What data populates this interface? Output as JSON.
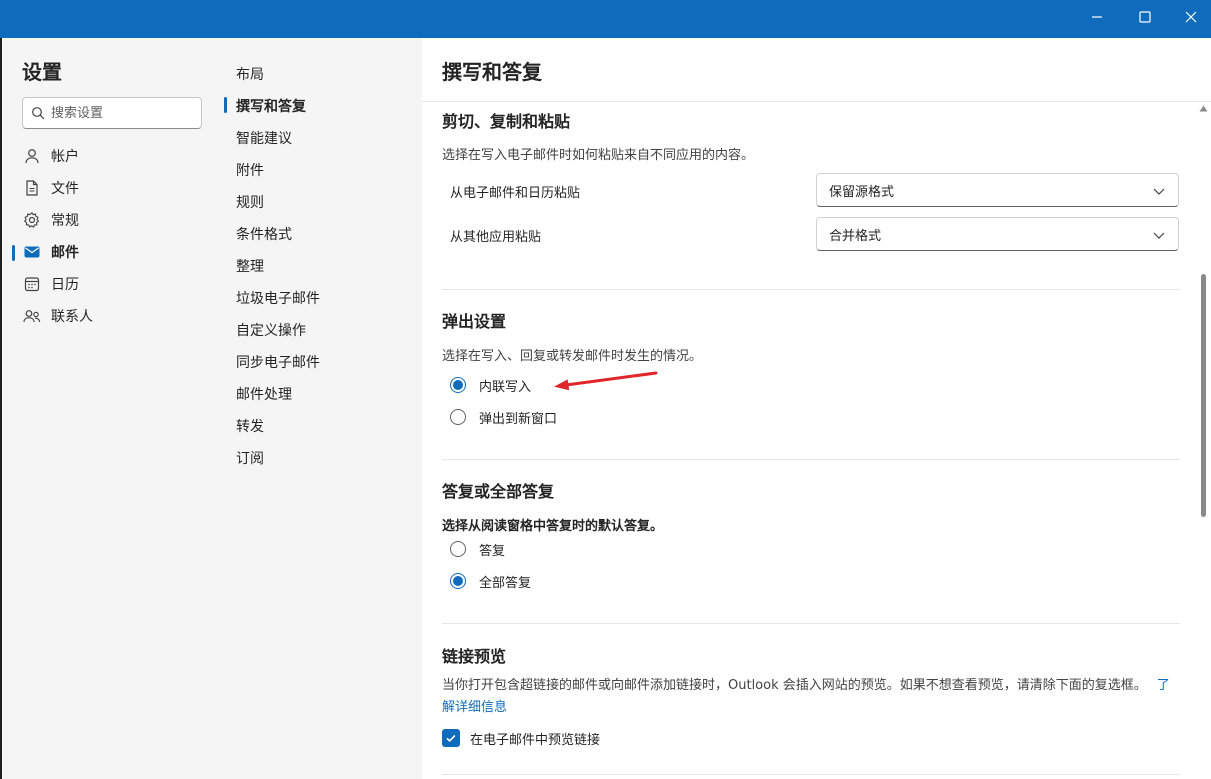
{
  "sidebar": {
    "title": "设置",
    "search_placeholder": "搜索设置",
    "items": [
      {
        "label": "帐户",
        "icon": "person-icon"
      },
      {
        "label": "文件",
        "icon": "document-icon"
      },
      {
        "label": "常规",
        "icon": "gear-icon"
      },
      {
        "label": "邮件",
        "icon": "mail-icon",
        "active": true
      },
      {
        "label": "日历",
        "icon": "calendar-icon"
      },
      {
        "label": "联系人",
        "icon": "people-icon"
      }
    ]
  },
  "subnav": {
    "items": [
      {
        "label": "布局"
      },
      {
        "label": "撰写和答复",
        "active": true
      },
      {
        "label": "智能建议"
      },
      {
        "label": "附件"
      },
      {
        "label": "规则"
      },
      {
        "label": "条件格式"
      },
      {
        "label": "整理"
      },
      {
        "label": "垃圾电子邮件"
      },
      {
        "label": "自定义操作"
      },
      {
        "label": "同步电子邮件"
      },
      {
        "label": "邮件处理"
      },
      {
        "label": "转发"
      },
      {
        "label": "订阅"
      }
    ]
  },
  "main": {
    "title": "撰写和答复",
    "paste": {
      "heading": "剪切、复制和粘贴",
      "description": "选择在写入电子邮件时如何粘贴来自不同应用的内容。",
      "rows": [
        {
          "label": "从电子邮件和日历粘贴",
          "value": "保留源格式"
        },
        {
          "label": "从其他应用粘贴",
          "value": "合并格式"
        }
      ]
    },
    "popout": {
      "heading": "弹出设置",
      "description": "选择在写入、回复或转发邮件时发生的情况。",
      "options": [
        {
          "label": "内联写入",
          "selected": true
        },
        {
          "label": "弹出到新窗口",
          "selected": false
        }
      ]
    },
    "reply": {
      "heading": "答复或全部答复",
      "description": "选择从阅读窗格中答复时的默认答复。",
      "options": [
        {
          "label": "答复",
          "selected": false
        },
        {
          "label": "全部答复",
          "selected": true
        }
      ]
    },
    "link_preview": {
      "heading": "链接预览",
      "description": "当你打开包含超链接的邮件或向邮件添加链接时，Outlook 会插入网站的预览。如果不想查看预览，请清除下面的复选框。",
      "learn_more": "了解详细信息",
      "checkbox_label": "在电子邮件中预览链接",
      "checked": true
    }
  },
  "colors": {
    "accent": "#0f6cbd",
    "annotation_arrow": "#e0262b"
  }
}
